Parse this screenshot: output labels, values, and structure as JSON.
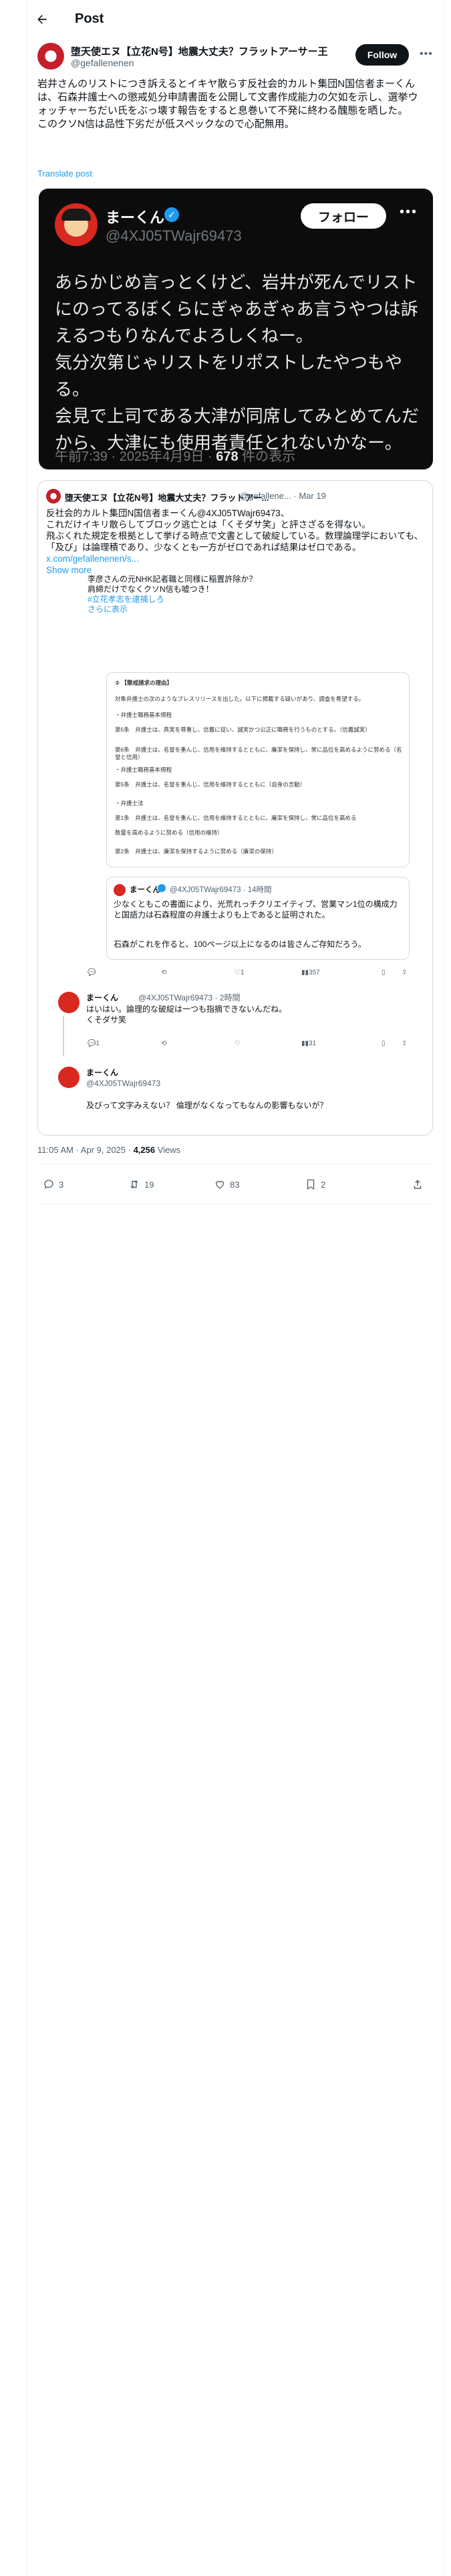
{
  "header": {
    "title": "Post"
  },
  "post": {
    "author_name": "堕天使エヌ【立花N号】地震大丈夫？フラットアーサー王",
    "author_handle": "@gefallenenen",
    "follow_label": "Follow",
    "text": "岩井さんのリストにつき訴えるとイキヤ散らす反社会的カルト集団N国信者まーくんは、石森井護士への懲戒処分申請書面を公開して文書作成能力の欠如を示し、選挙ウォッチャーちだい氏をぶっ壊す報告をすると息巻いて不発に終わる醜態を晒した。\nこのクソN信は品性下劣だが低スペックなので心配無用。",
    "translate_label": "Translate post"
  },
  "embedded_image": {
    "name": "まーくん",
    "handle": "@4XJ05TWajr69473",
    "follow_label": "フォロー",
    "text": "あらかじめ言っとくけど、岩井が死んでリストにのってるぼくらにぎゃあぎゃあ言うやつは訴えるつもりなんでよろしくねー。\n気分次第じゃリストをリポストしたやつもやる。\n会見で上司である大津が同席してみとめてんだから、大津にも使用者責任とれないかなー。",
    "time": "午前7:39 · 2025年4月9日 · ",
    "views_count": "678",
    "views_label": " 件の表示"
  },
  "quote": {
    "author_name": "堕天使エヌ【立花N号】地震大丈夫？フラットアー...",
    "handle_date": "@gefallene... · Mar 19",
    "text": "反社会的カルト集団N国信者まーくん@4XJ05TWajr69473、\nこれだけイキリ散らしてブロック逃亡とは「くそダサ笑」と評さざるを得ない。\n飛ぶくれた規定を根拠として挙げる時点で文書として破綻している。数理論理学においても、「及び」は論理積であり、少なくとも一方がゼロであれば結果はゼロである。",
    "link_text": "x.com/gefallenenen/s...",
    "show_more": "Show more"
  },
  "clip": {
    "lead_text": "李彦さんの元NHK記者職と同様に稲置許除か？\n肩締だけでなくクソN信も嘘つき！",
    "tag1": "#立花孝志を逮捕しろ",
    "tag2": "さらに表示",
    "doc_lines": [
      "② 【懲戒請求の理由】",
      "対象弁護士の次のようなブレスリリースを出した。以下に掲載する疑いがあり、調査を希望する。",
      "・弁護士職務基本規程",
      "第5条　弁護士は、真実を尊重し、信義に従い、誠実かつ公正に職務を行うものとする。（信義誠実）",
      "第6条　弁護士は、名誉を重んじ、信用を維持するとともに、廉潔を保持し、常に品位を高めるように努める（名誉と信用）",
      "・弁護士職務基本規程",
      "第5条　弁護士は、名誉を重んじ、信用を維持するとともに（自身の言動）",
      "・弁護士法",
      "第1条　弁護士は、名誉を重んじ、信用を維持するとともに、廉潔を保持し、常に品位を高める",
      "数量を高めるように努める（信用の維持）",
      "第2条　弁護士は、廉潔を保持するように努める（廉潔の保持）"
    ],
    "inner_quote": {
      "name": "まーくん",
      "handle": "@4XJ05TWajr69473 · 14時間",
      "text": "少なくともこの書面により、光荒れっチクリエイティブ、営業マン1位の構成力と国語力は石森程度の弁護士よりも上であると証明された。",
      "text2": "石森がこれを作ると、100ページ以上になるのは皆さんご存知だろう。"
    },
    "actions1": {
      "reply": "",
      "repost": "",
      "like": "1",
      "views": "357"
    },
    "reply1": {
      "name": "まーくん",
      "handle": "@4XJ05TWajr69473 · 2時間",
      "text": "はいはい。論理的な破綻は一つも指摘できないんだね。\nくそダサ笑"
    },
    "actions2": {
      "reply": "1",
      "views": "31"
    },
    "reply2": {
      "name": "まーくん",
      "handle": "@4XJ05TWajr69473",
      "text": "及びって文字みえない？\n倫理がなくなってもなんの影響もないが？"
    }
  },
  "meta": {
    "timestamp": "11:05 AM · Apr 9, 2025 · ",
    "views_count": "4,256",
    "views_label": " Views"
  },
  "actions": {
    "replies": "3",
    "reposts": "19",
    "likes": "83",
    "bookmarks": "2"
  },
  "colors": {
    "accent": "#1d9bf0",
    "text": "#0f1419",
    "muted": "#536471",
    "brand_red": "#c41f2b"
  }
}
